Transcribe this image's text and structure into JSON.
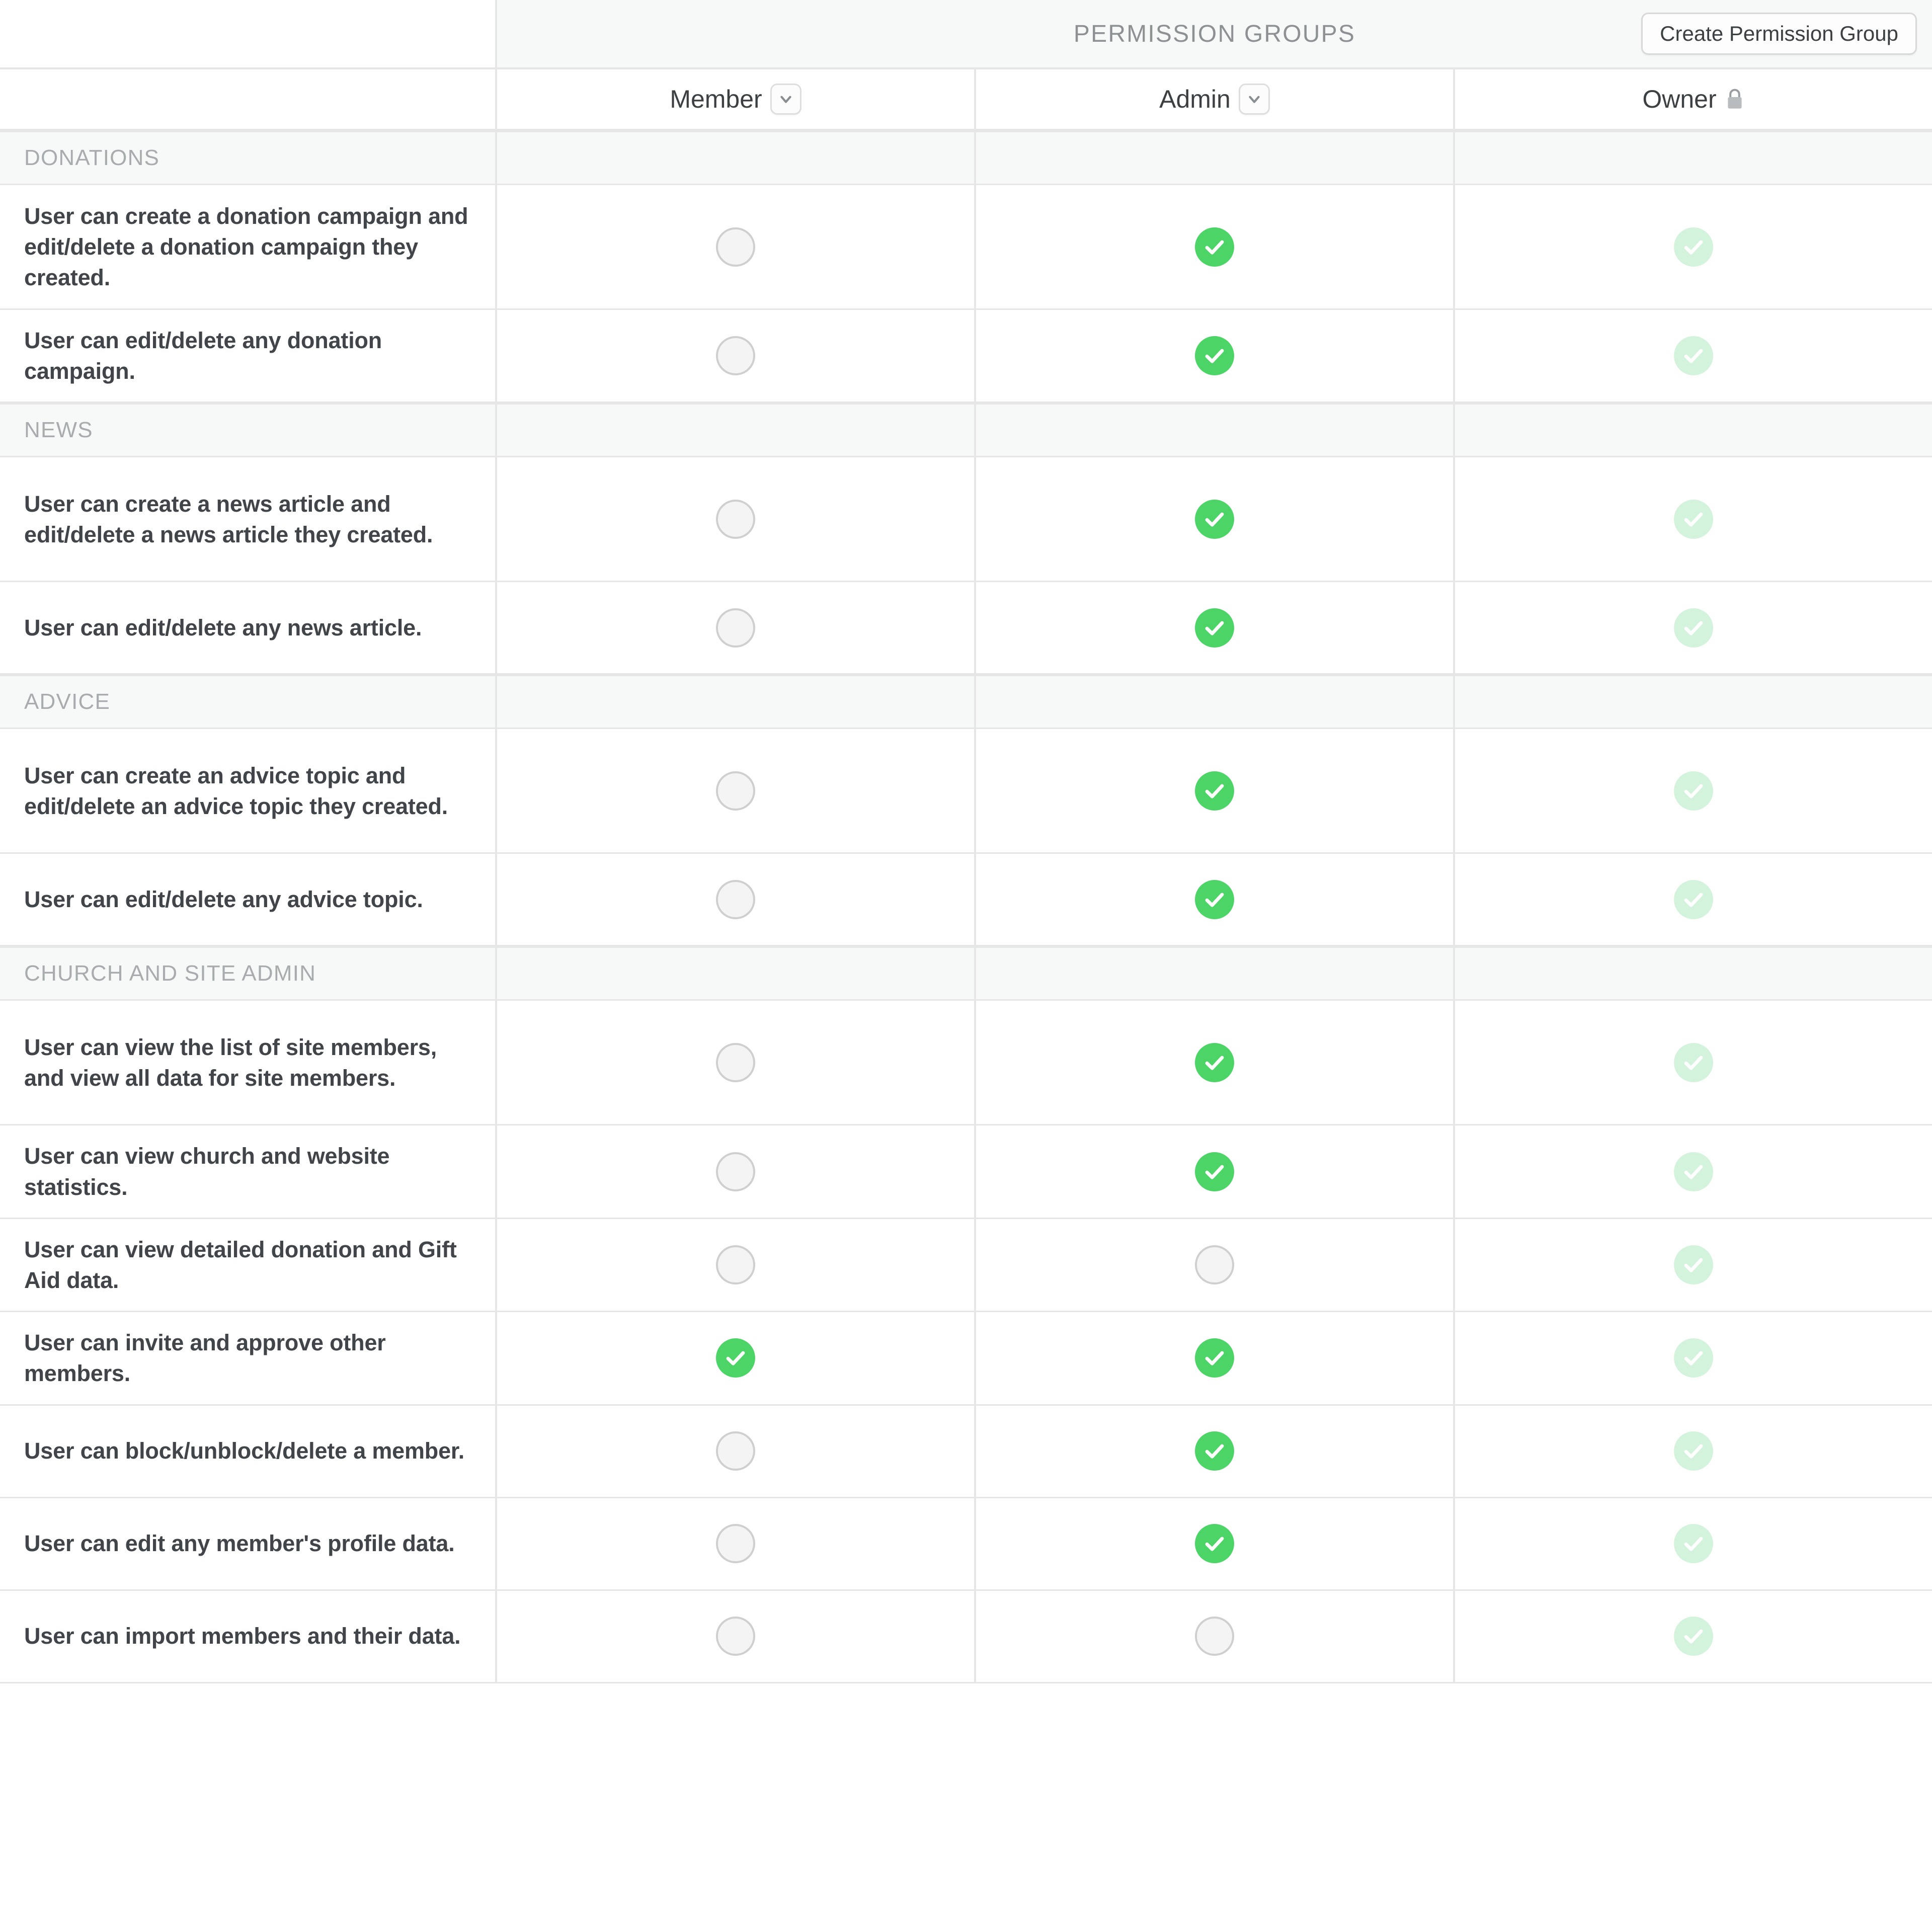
{
  "header": {
    "banner_title": "PERMISSION GROUPS",
    "create_button_label": "Create Permission Group"
  },
  "columns": [
    {
      "key": "member",
      "label": "Member",
      "control": "chevron-down-icon"
    },
    {
      "key": "admin",
      "label": "Admin",
      "control": "chevron-down-icon"
    },
    {
      "key": "owner",
      "label": "Owner",
      "control": "lock-icon"
    }
  ],
  "colors": {
    "check_on": "#4cd566",
    "check_locked": "#d4f3dc",
    "check_off_fill": "#f4f4f4",
    "check_off_border": "#cfcfcf",
    "band": "#f7f9f8",
    "grid_line": "#e6e6e6",
    "text_primary": "#41454a",
    "text_muted": "#a9acae"
  },
  "sections": [
    {
      "title": "DONATIONS",
      "rows": [
        {
          "text": "User can create a donation campaign and edit/delete a donation campaign they created.",
          "lines": 3,
          "member": "off",
          "admin": "on",
          "owner": "locked"
        },
        {
          "text": "User can edit/delete any donation campaign.",
          "lines": 2,
          "member": "off",
          "admin": "on",
          "owner": "locked"
        }
      ]
    },
    {
      "title": "NEWS",
      "rows": [
        {
          "text": "User can create a news article and edit/delete a news article they created.",
          "lines": 3,
          "member": "off",
          "admin": "on",
          "owner": "locked"
        },
        {
          "text": "User can edit/delete any news article.",
          "lines": 2,
          "member": "off",
          "admin": "on",
          "owner": "locked"
        }
      ]
    },
    {
      "title": "ADVICE",
      "rows": [
        {
          "text": "User can create an advice topic and edit/delete an advice topic they created.",
          "lines": 3,
          "member": "off",
          "admin": "on",
          "owner": "locked"
        },
        {
          "text": "User can edit/delete any advice topic.",
          "lines": 2,
          "member": "off",
          "admin": "on",
          "owner": "locked"
        }
      ]
    },
    {
      "title": "CHURCH AND SITE ADMIN",
      "rows": [
        {
          "text": "User can view the list of site members, and view all data for site members.",
          "lines": 3,
          "member": "off",
          "admin": "on",
          "owner": "locked"
        },
        {
          "text": "User can view church and website statistics.",
          "lines": 2,
          "member": "off",
          "admin": "on",
          "owner": "locked"
        },
        {
          "text": "User can view detailed donation and Gift Aid data.",
          "lines": 2,
          "member": "off",
          "admin": "off",
          "owner": "locked"
        },
        {
          "text": "User can invite and approve other members.",
          "lines": 2,
          "member": "on",
          "admin": "on",
          "owner": "locked"
        },
        {
          "text": "User can block/unblock/delete a member.",
          "lines": 2,
          "member": "off",
          "admin": "on",
          "owner": "locked"
        },
        {
          "text": "User can edit any member's profile data.",
          "lines": 2,
          "member": "off",
          "admin": "on",
          "owner": "locked"
        },
        {
          "text": "User can import members and their data.",
          "lines": 2,
          "member": "off",
          "admin": "off",
          "owner": "locked"
        }
      ]
    }
  ]
}
